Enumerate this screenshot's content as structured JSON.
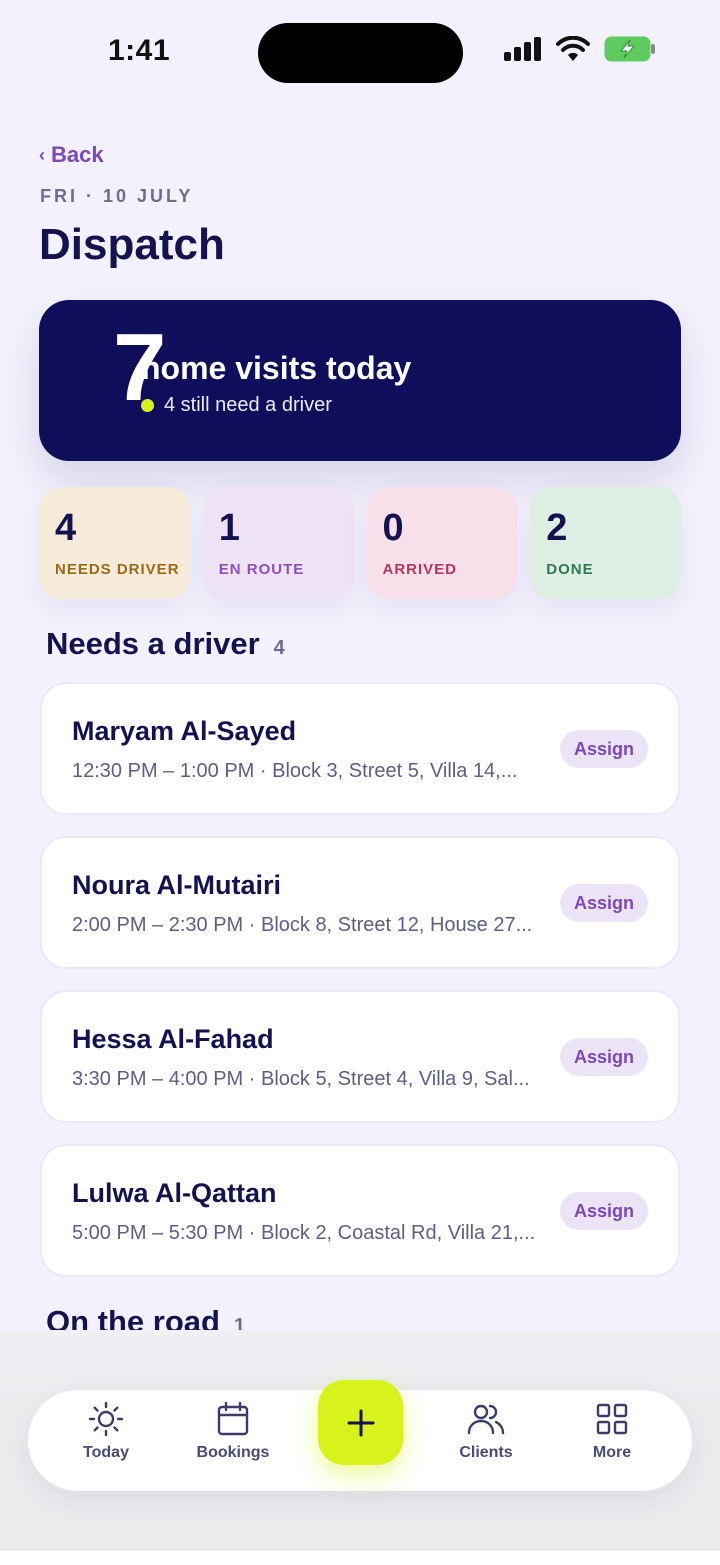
{
  "status": {
    "time": "1:41"
  },
  "nav": {
    "back_label": "Back"
  },
  "header": {
    "date": "FRI · 10 JULY",
    "title": "Dispatch"
  },
  "hero": {
    "count": "7",
    "main": "home visits today",
    "sub": "4 still need a driver"
  },
  "stats": [
    {
      "value": "4",
      "label": "NEEDS DRIVER"
    },
    {
      "value": "1",
      "label": "EN ROUTE"
    },
    {
      "value": "0",
      "label": "ARRIVED"
    },
    {
      "value": "2",
      "label": "DONE"
    }
  ],
  "sections": {
    "needs_driver": {
      "title": "Needs a driver",
      "count": "4"
    },
    "on_the_road": {
      "title": "On the road",
      "count": "1"
    }
  },
  "visits": [
    {
      "name": "Maryam Al-Sayed",
      "meta": "12:30 PM – 1:00 PM · Block 3, Street 5, Villa 14,...",
      "action": "Assign"
    },
    {
      "name": "Noura Al-Mutairi",
      "meta": "2:00 PM – 2:30 PM · Block 8, Street 12, House 27...",
      "action": "Assign"
    },
    {
      "name": "Hessa Al-Fahad",
      "meta": "3:30 PM – 4:00 PM · Block 5, Street 4, Villa 9, Sal...",
      "action": "Assign"
    },
    {
      "name": "Lulwa Al-Qattan",
      "meta": "5:00 PM – 5:30 PM · Block 2, Coastal Rd, Villa 21,...",
      "action": "Assign"
    }
  ],
  "tabbar": {
    "today": "Today",
    "bookings": "Bookings",
    "add": "+",
    "clients": "Clients",
    "more": "More"
  },
  "colors": {
    "accent": "#7a48b8",
    "navy": "#0e0e5a",
    "lime": "#d8f21c",
    "background": "#f3f1fd"
  }
}
